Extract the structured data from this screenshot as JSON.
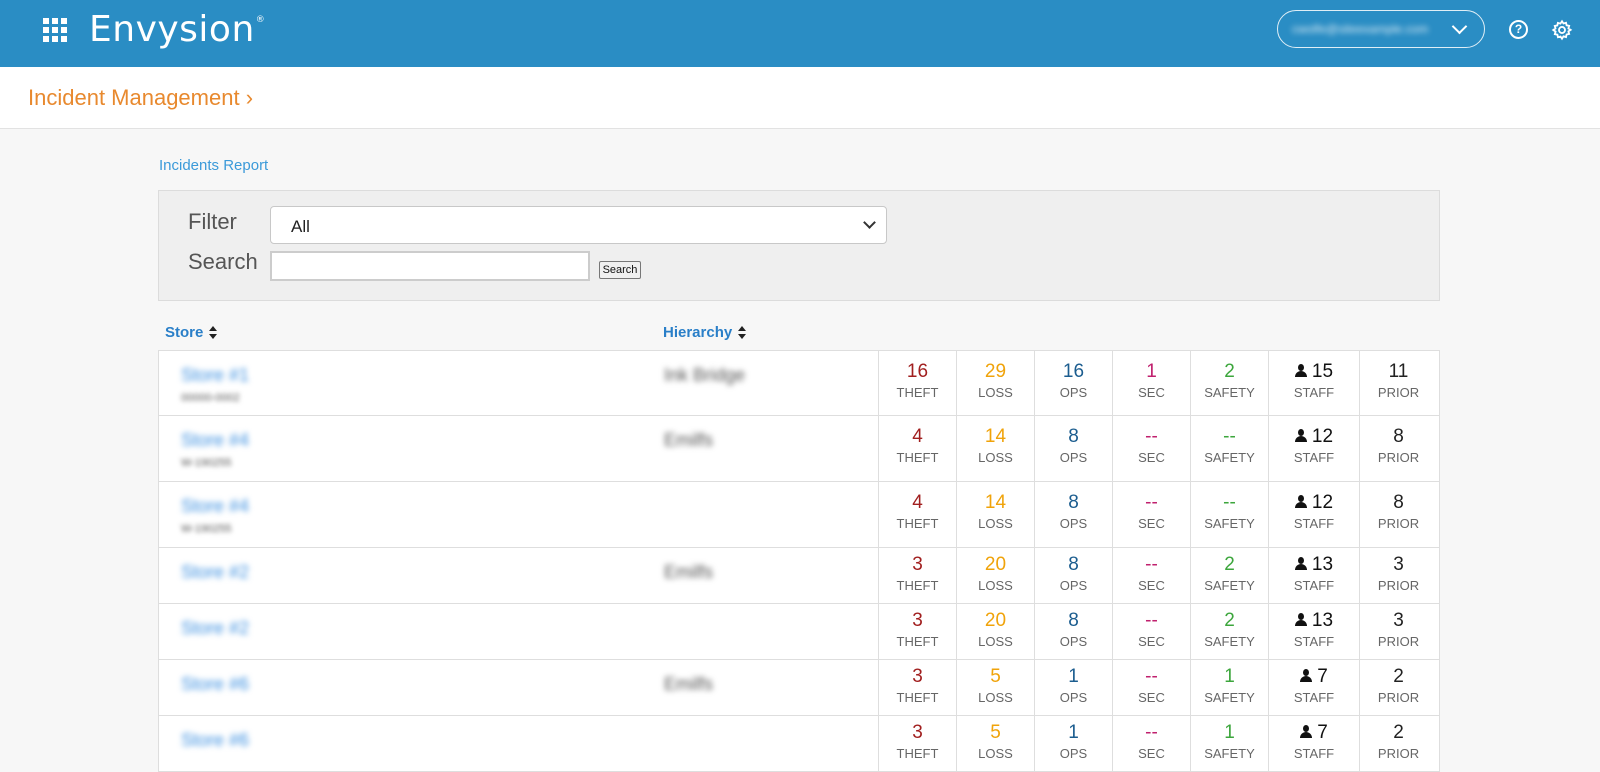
{
  "header": {
    "brand": "Envysion",
    "brand_mark": "®",
    "user_email": "cwolfe@siteexample.com"
  },
  "page": {
    "title": "Incident Management ›",
    "report_link": "Incidents Report"
  },
  "filters": {
    "filter_label": "Filter",
    "filter_value": "All",
    "search_label": "Search",
    "search_placeholder": "",
    "search_button": "Search"
  },
  "columns": {
    "store": "Store",
    "hierarchy": "Hierarchy"
  },
  "metric_labels": {
    "theft": "THEFT",
    "loss": "LOSS",
    "ops": "OPS",
    "sec": "SEC",
    "safety": "SAFETY",
    "staff": "STAFF",
    "prior": "PRIOR"
  },
  "colors": {
    "theft": "#a11f1f",
    "loss": "#f0a30a",
    "ops": "#1c5d8f",
    "sec": "#c0206e",
    "safety": "#3ca63c",
    "staff": "#111111",
    "prior": "#222222",
    "accent": "#2a8dc4",
    "title": "#e8892e"
  },
  "rows": [
    {
      "store": "Store #1",
      "store_sub": "00000-0002",
      "hierarchy": "Ink Bridge",
      "theft": "16",
      "loss": "29",
      "ops": "16",
      "sec": "1",
      "safety": "2",
      "staff": "15",
      "prior": "11"
    },
    {
      "store": "Store #4",
      "store_sub": "W-190255",
      "hierarchy": "Emilfs",
      "theft": "4",
      "loss": "14",
      "ops": "8",
      "sec": "--",
      "safety": "--",
      "staff": "12",
      "prior": "8"
    },
    {
      "store": "Store #4",
      "store_sub": "W-190255",
      "hierarchy": "",
      "theft": "4",
      "loss": "14",
      "ops": "8",
      "sec": "--",
      "safety": "--",
      "staff": "12",
      "prior": "8"
    },
    {
      "store": "Store #2",
      "store_sub": "",
      "hierarchy": "Emilfs",
      "theft": "3",
      "loss": "20",
      "ops": "8",
      "sec": "--",
      "safety": "2",
      "staff": "13",
      "prior": "3"
    },
    {
      "store": "Store #2",
      "store_sub": "",
      "hierarchy": "",
      "theft": "3",
      "loss": "20",
      "ops": "8",
      "sec": "--",
      "safety": "2",
      "staff": "13",
      "prior": "3"
    },
    {
      "store": "Store #6",
      "store_sub": "",
      "hierarchy": "Emilfs",
      "theft": "3",
      "loss": "5",
      "ops": "1",
      "sec": "--",
      "safety": "1",
      "staff": "7",
      "prior": "2"
    },
    {
      "store": "Store #6",
      "store_sub": "",
      "hierarchy": "",
      "theft": "3",
      "loss": "5",
      "ops": "1",
      "sec": "--",
      "safety": "1",
      "staff": "7",
      "prior": "2"
    }
  ]
}
